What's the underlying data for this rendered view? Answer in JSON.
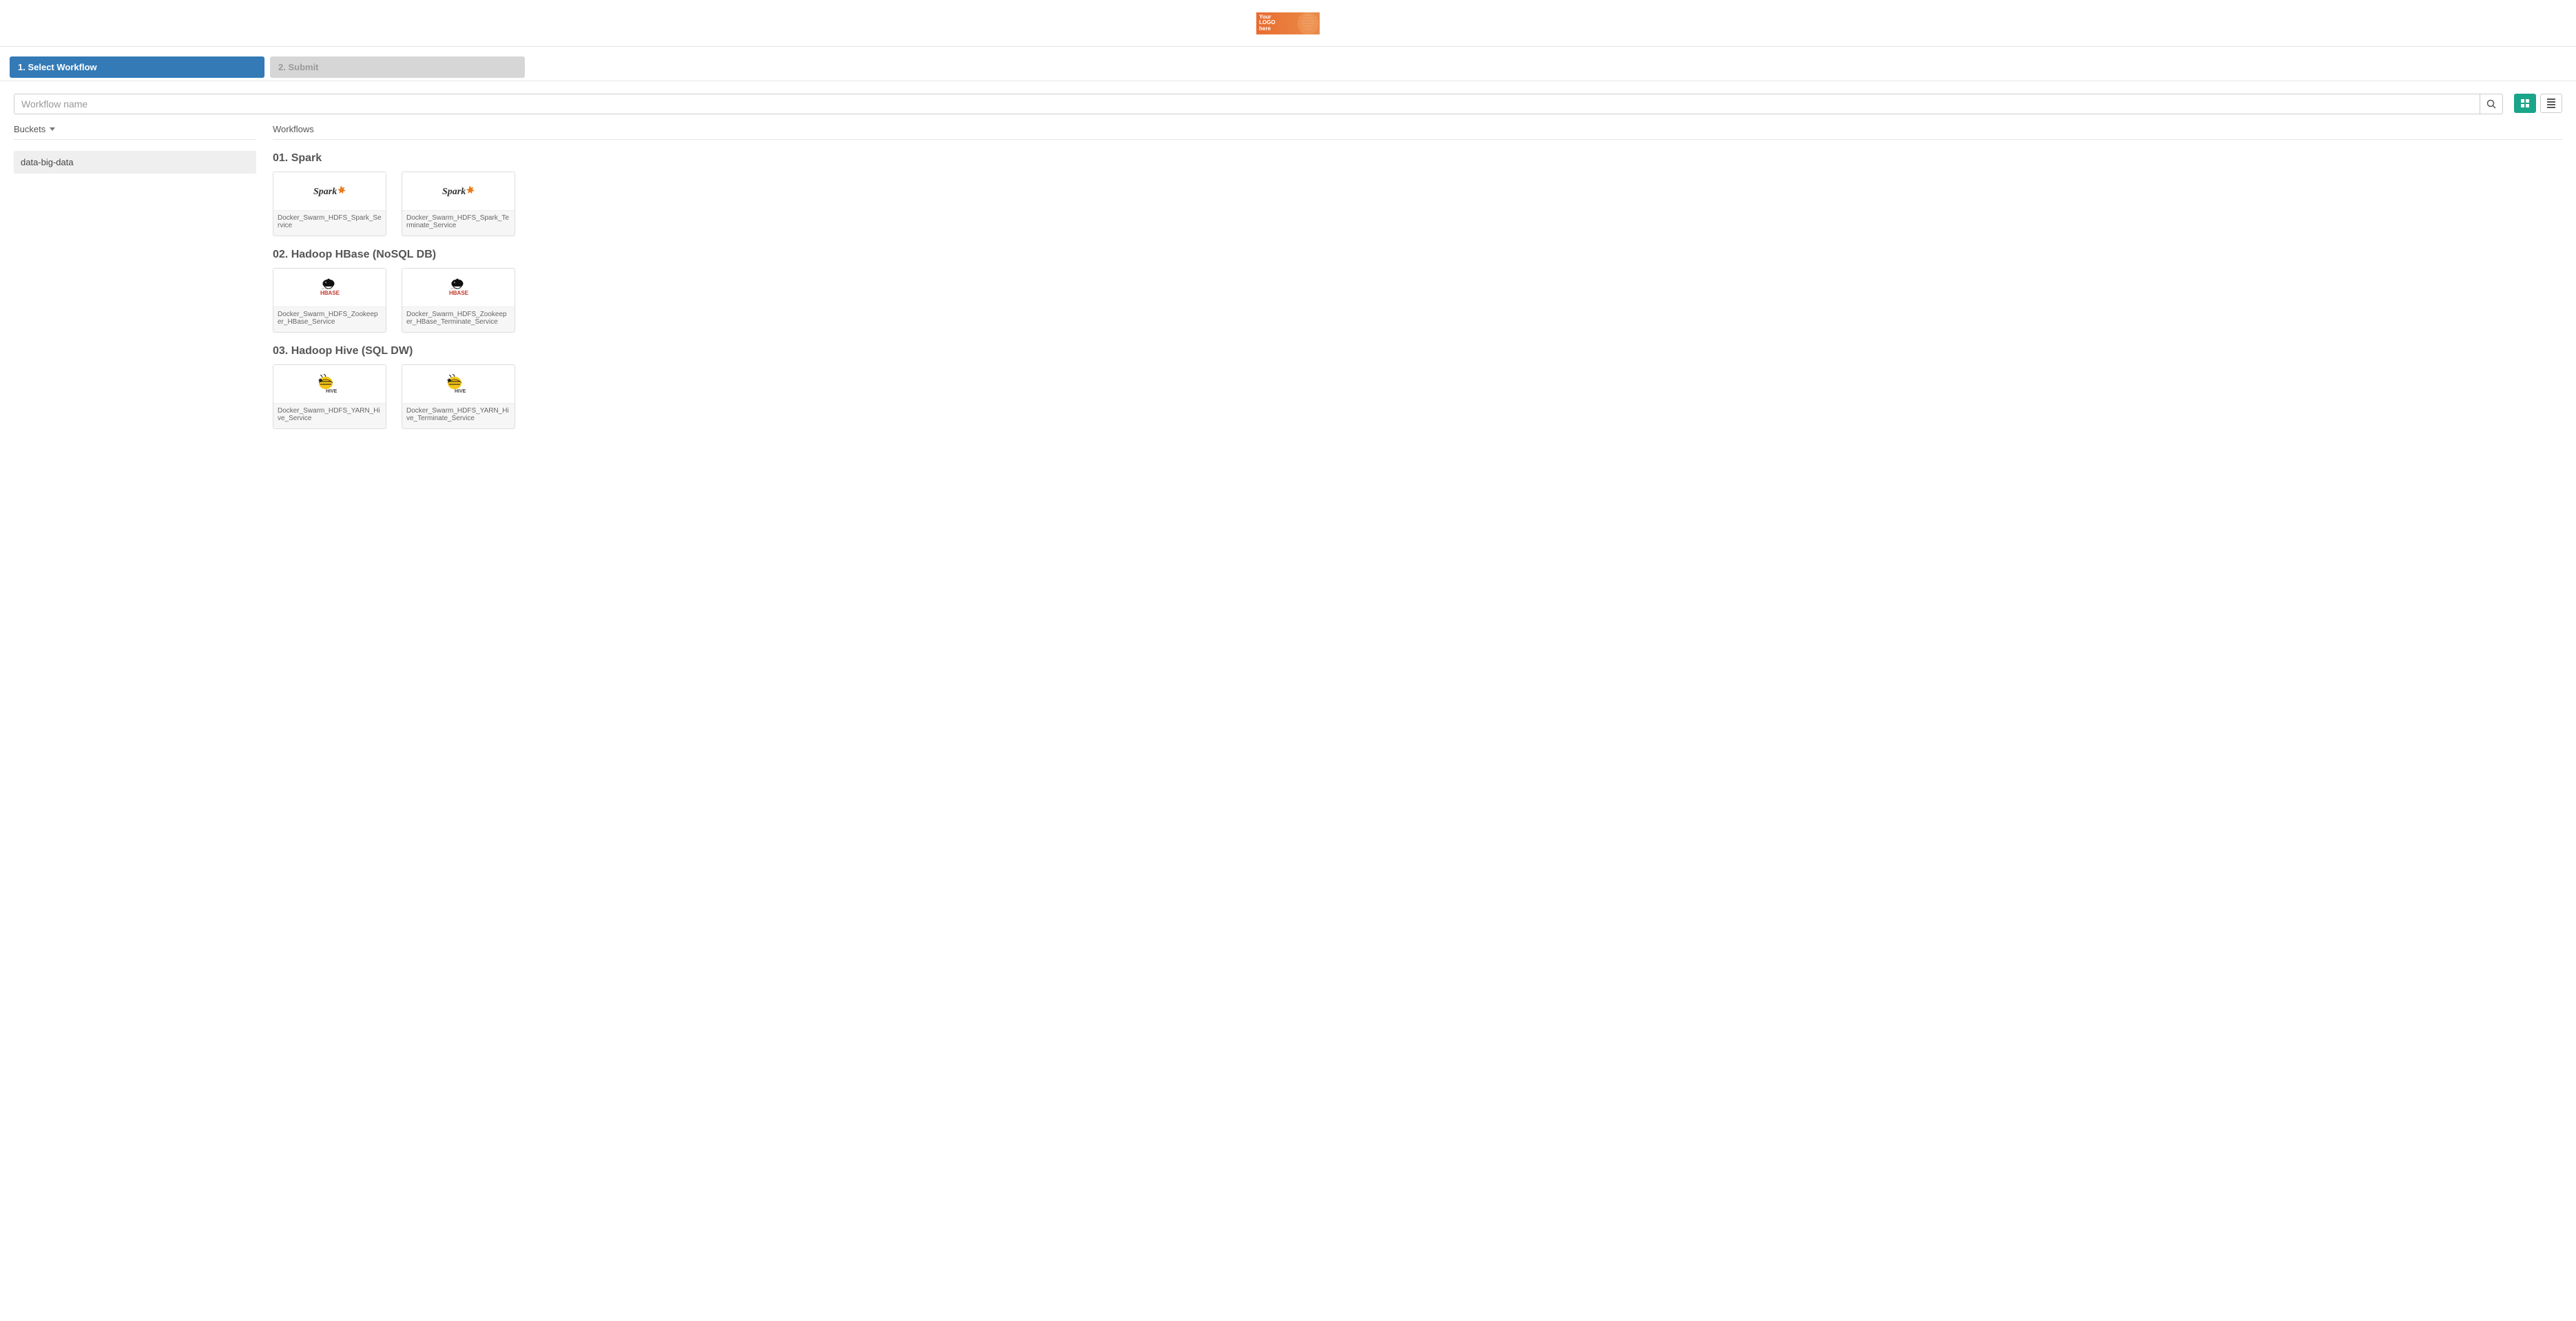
{
  "logo": {
    "line1": "Your",
    "line2": "LOGO",
    "line3": "here"
  },
  "steps": [
    {
      "label": "1. Select Workflow",
      "state": "active"
    },
    {
      "label": "2. Submit",
      "state": "disabled"
    }
  ],
  "search": {
    "placeholder": "Workflow name"
  },
  "view": {
    "active": "grid"
  },
  "sidebar": {
    "title": "Buckets",
    "items": [
      {
        "label": "data-big-data",
        "selected": true
      }
    ]
  },
  "main": {
    "title": "Workflows",
    "groups": [
      {
        "title": "01. Spark",
        "icon": "spark",
        "cards": [
          {
            "name": "Docker_Swarm_HDFS_Spark_Service"
          },
          {
            "name": "Docker_Swarm_HDFS_Spark_Terminate_Service"
          }
        ]
      },
      {
        "title": "02. Hadoop HBase (NoSQL DB)",
        "icon": "hbase",
        "cards": [
          {
            "name": "Docker_Swarm_HDFS_Zookeeper_HBase_Service"
          },
          {
            "name": "Docker_Swarm_HDFS_Zookeeper_HBase_Terminate_Service"
          }
        ]
      },
      {
        "title": "03. Hadoop Hive (SQL DW)",
        "icon": "hive",
        "cards": [
          {
            "name": "Docker_Swarm_HDFS_YARN_Hive_Service"
          },
          {
            "name": "Docker_Swarm_HDFS_YARN_Hive_Terminate_Service"
          }
        ]
      }
    ]
  }
}
